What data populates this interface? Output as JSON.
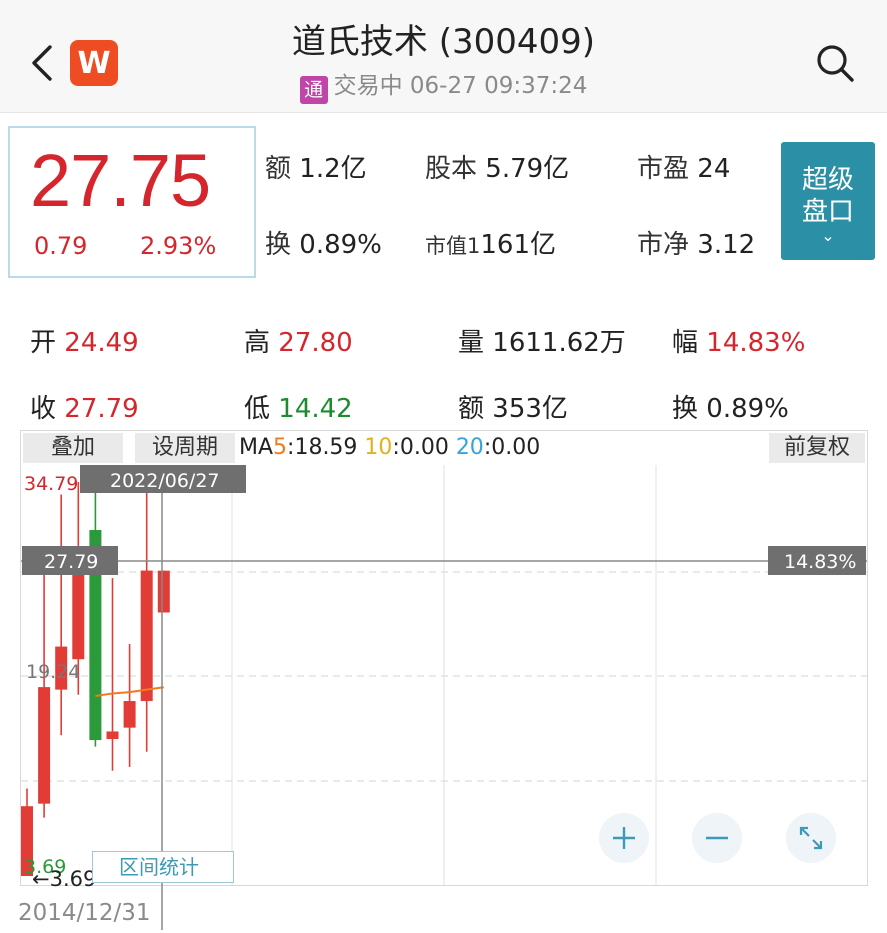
{
  "header": {
    "title": "道氏技术 (300409)",
    "tong_badge": "通",
    "status": "交易中 06-27 09:37:24",
    "logo_letter": "W"
  },
  "quote": {
    "price": "27.75",
    "change": "0.79",
    "change_pct": "2.93%",
    "stats": [
      {
        "label": "额",
        "value": "1.2亿"
      },
      {
        "label": "股本",
        "value": "5.79亿"
      },
      {
        "label": "市盈",
        "value": "24"
      },
      {
        "label": "换",
        "value": "0.89%"
      },
      {
        "label": "市值1",
        "value": "161亿"
      },
      {
        "label": "市净",
        "value": "3.12"
      }
    ],
    "super_button": {
      "line1": "超级",
      "line2": "盘口",
      "chevron": "⌄"
    }
  },
  "period_stats": {
    "row1": [
      {
        "label": "开",
        "value": "24.49"
      },
      {
        "label": "高",
        "value": "27.80"
      },
      {
        "label": "量",
        "value": "1611.62万"
      },
      {
        "label": "幅",
        "value": "14.83%"
      }
    ],
    "row2": [
      {
        "label": "收",
        "value": "27.79"
      },
      {
        "label": "低",
        "value": "14.42"
      },
      {
        "label": "额",
        "value": "353亿"
      },
      {
        "label": "换",
        "value": "0.89%"
      }
    ]
  },
  "chart_toolbar": {
    "overlay_tab": "叠加",
    "period_tab": "设周期",
    "ma_prefix": "MA",
    "ma5_key": "5",
    "ma5_val": ":18.59 ",
    "ma10_key": "10",
    "ma10_val": ":0.00 ",
    "ma20_key": "20",
    "ma20_val": ":0.00",
    "adjust_tab": "前复权"
  },
  "chart_labels": {
    "top_price": "34.79",
    "cursor_date": "2022/06/27",
    "cursor_price": "27.79",
    "cursor_pct": "14.83%",
    "mid_price": "19.24",
    "low_price": "3.69",
    "low_marker": "←3.69",
    "range_button": "区间统计",
    "start_date": "2014/12/31"
  },
  "chart_data": {
    "type": "candlestick",
    "ylim": [
      3.69,
      34.79
    ],
    "colors": {
      "up": "#e23c37",
      "down": "#2a9a3a",
      "ma5": "#f07a1d"
    },
    "candles": [
      {
        "open": 3.69,
        "close": 9.2,
        "low": 3.69,
        "high": 10.6
      },
      {
        "open": 9.4,
        "close": 18.6,
        "low": 8.3,
        "high": 29.6
      },
      {
        "open": 18.4,
        "close": 21.8,
        "low": 14.8,
        "high": 33.8
      },
      {
        "open": 20.8,
        "close": 28.0,
        "low": 18.0,
        "high": 34.79
      },
      {
        "open": 31.0,
        "close": 14.42,
        "low": 13.9,
        "high": 34.2
      },
      {
        "open": 14.5,
        "close": 15.1,
        "low": 12.0,
        "high": 27.2
      },
      {
        "open": 15.4,
        "close": 17.5,
        "low": 12.3,
        "high": 22.0
      },
      {
        "open": 17.5,
        "close": 27.8,
        "low": 13.5,
        "high": 34.3
      },
      {
        "open": 24.49,
        "close": 27.79,
        "low": 24.49,
        "high": 27.8
      }
    ],
    "ma5": [
      null,
      null,
      null,
      null,
      17.9,
      18.1,
      18.2,
      18.4,
      18.59
    ]
  },
  "controls": {
    "zoom_in": "+",
    "zoom_out": "−"
  }
}
